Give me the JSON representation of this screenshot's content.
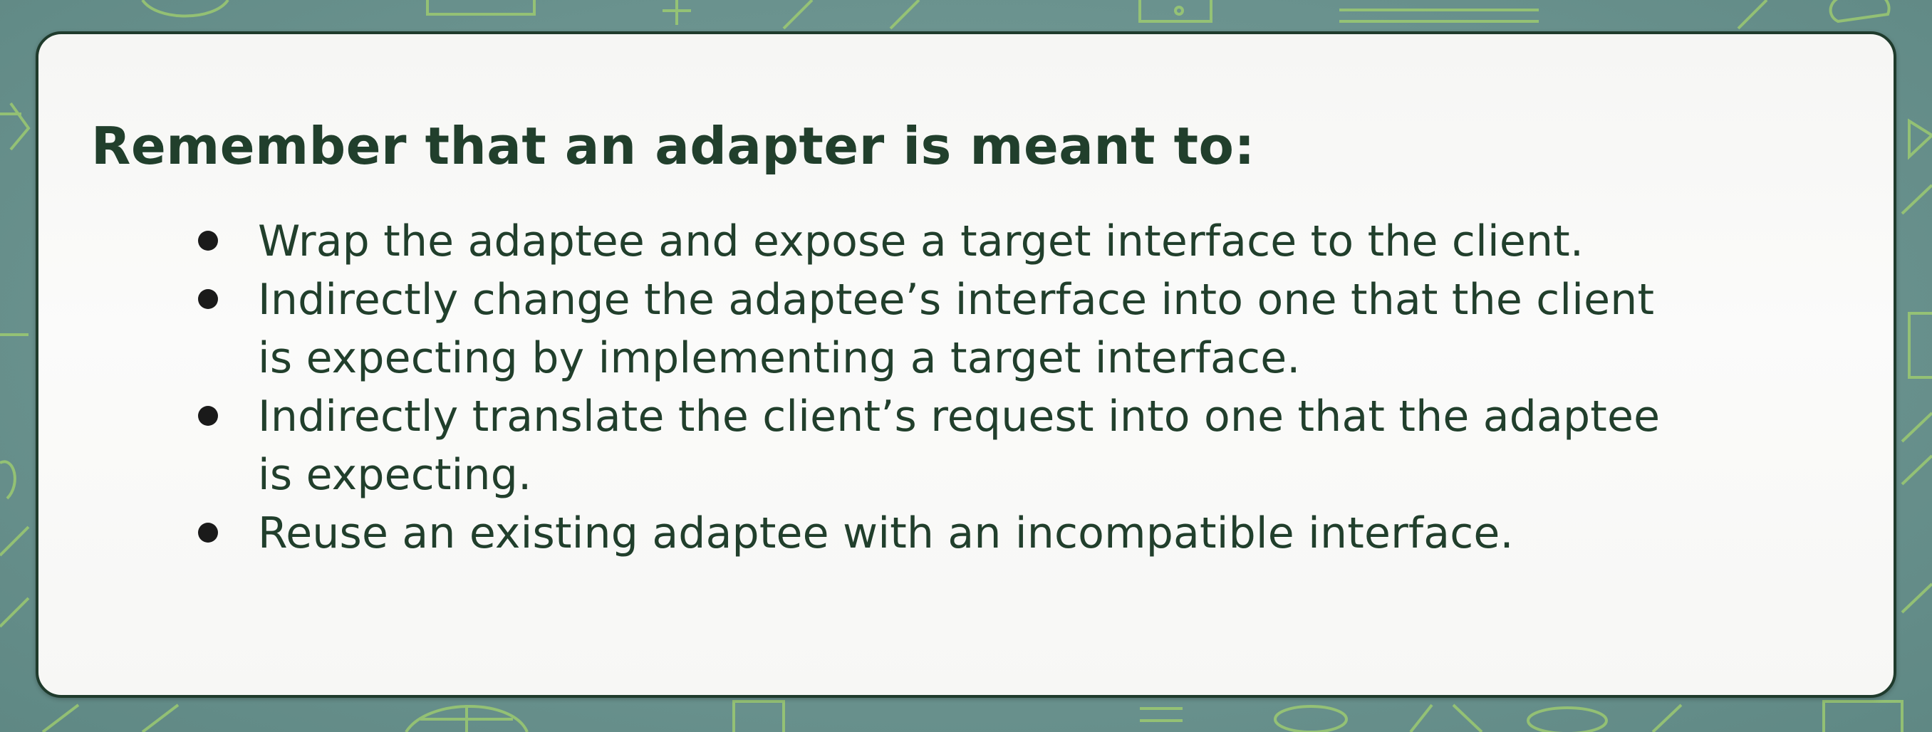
{
  "heading": "Remember that an adapter is meant to:",
  "bullets": [
    {
      "line1": "Wrap the adaptee and expose a target interface to the client.",
      "line2": ""
    },
    {
      "line1": "Indirectly change the adaptee’s interface into one that the client",
      "line2": "is expecting by implementing a target interface."
    },
    {
      "line1": "Indirectly translate the client’s request into one that the adaptee",
      "line2": "is expecting."
    },
    {
      "line1": "Reuse an existing adaptee with an incompatible interface.",
      "line2": ""
    }
  ],
  "colors": {
    "background": "#6f9693",
    "pattern": "#9fd06a",
    "card": "#f8f8f6",
    "card_border": "#1f3b2c",
    "text": "#213f2c",
    "bullet": "#1a1a1a"
  }
}
